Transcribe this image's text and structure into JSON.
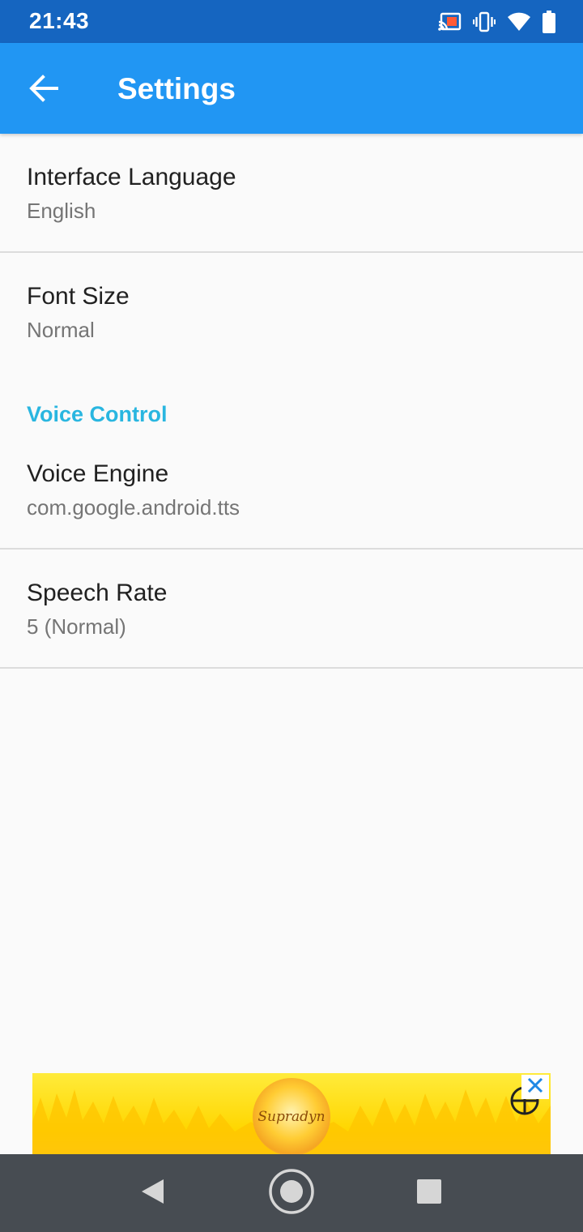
{
  "status_bar": {
    "time": "21:43",
    "icons": [
      "cast-icon",
      "vibrate-icon",
      "wifi-icon",
      "battery-icon"
    ]
  },
  "app_bar": {
    "title": "Settings",
    "back_icon": "arrow-left-icon"
  },
  "preferences": [
    {
      "title": "Interface Language",
      "summary": "English"
    },
    {
      "title": "Font Size",
      "summary": "Normal"
    }
  ],
  "voice_section": {
    "category": "Voice Control",
    "items": [
      {
        "title": "Voice Engine",
        "summary": "com.google.android.tts"
      },
      {
        "title": "Speech Rate",
        "summary": "5 (Normal)"
      }
    ]
  },
  "ad": {
    "brand": "Supradyn",
    "close_icon": "close-icon"
  },
  "nav_bar": {
    "icons": [
      "back-triangle-icon",
      "home-circle-icon",
      "recents-square-icon"
    ]
  },
  "colors": {
    "status_bar": "#1565c0",
    "app_bar": "#2196f3",
    "category": "#29b6e0",
    "summary": "#757575",
    "nav_bar": "#474c52"
  }
}
